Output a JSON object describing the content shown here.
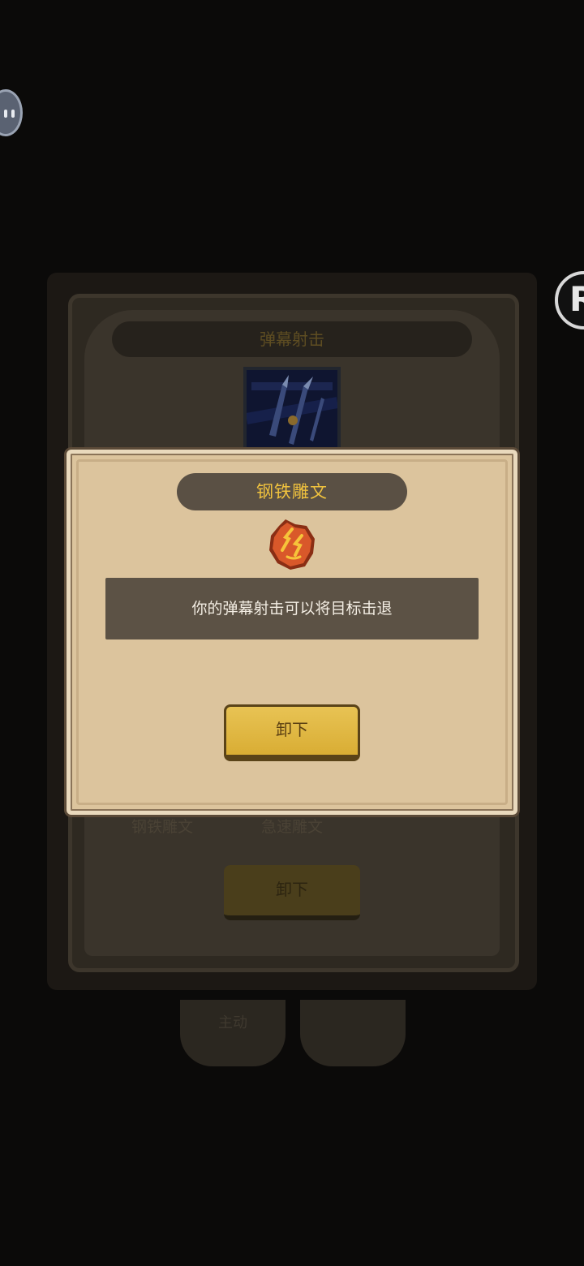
{
  "background_panel": {
    "title": "弹幕射击",
    "slot_labels": [
      "钢铁雕文",
      "急速雕文"
    ],
    "button_label": "卸下",
    "tabs": [
      {
        "label": "主动"
      },
      {
        "label": ""
      }
    ]
  },
  "popup": {
    "title": "钢铁雕文",
    "icon": "rune-glyph-icon",
    "description": "你的弹幕射击可以将目标击退",
    "button_label": "卸下"
  },
  "overlay_widgets": {
    "right_bubble_text": "R"
  },
  "colors": {
    "title_gold": "#f0c23e",
    "parchment": "#dcc49d",
    "button_gold": "#e0b540",
    "rune_orange": "#d9582a"
  }
}
